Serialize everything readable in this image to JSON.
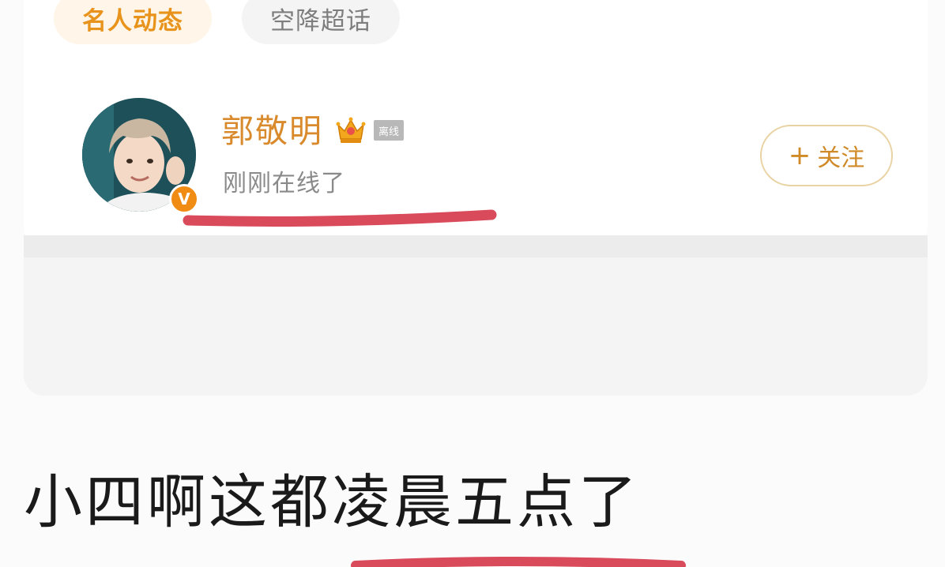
{
  "tabs": [
    {
      "label": "名人动态",
      "active": true
    },
    {
      "label": "空降超话",
      "active": false
    }
  ],
  "profile": {
    "name": "郭敬明",
    "crown_icon": "crown-icon",
    "offline_tag": "离线",
    "status": "刚刚在线了",
    "verified_mark": "V",
    "avatar_icon": "avatar-photo"
  },
  "follow_button": {
    "plus": "+",
    "label": "关注"
  },
  "caption": "小四啊这都凌晨五点了",
  "colors": {
    "accent_orange": "#e8941c",
    "name_color": "#d98a2c",
    "highlight_red": "#d94a5a",
    "verified_badge": "#f08c13"
  }
}
